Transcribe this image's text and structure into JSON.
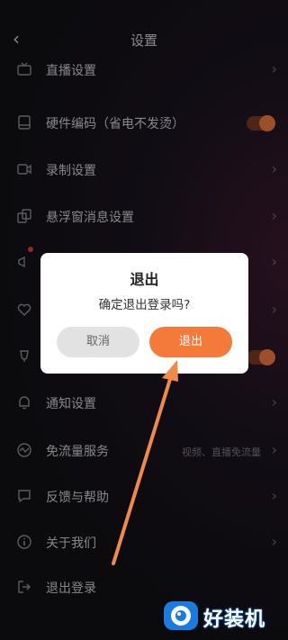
{
  "header": {
    "title": "设置",
    "back_icon": "chevron-left-icon"
  },
  "settings": {
    "items": [
      {
        "label": "直播设置",
        "icon": "tv-icon",
        "extra": "",
        "has_chevron": true
      },
      {
        "label": "硬件编码（省电不发烫）",
        "icon": "tablet-icon",
        "toggle": "on"
      },
      {
        "label": "录制设置",
        "icon": "video-camera-icon",
        "has_chevron": true
      },
      {
        "label": "悬浮窗消息设置",
        "icon": "floating-window-icon",
        "has_chevron": true
      },
      {
        "label": "",
        "icon": "megaphone-icon",
        "has_chevron": true
      },
      {
        "label": "",
        "icon": "heart-icon",
        "has_chevron": true
      },
      {
        "label": "",
        "icon": "trophy-icon",
        "toggle": "on"
      },
      {
        "label": "通知设置",
        "icon": "bell-icon",
        "has_chevron": true
      },
      {
        "label": "免流量服务",
        "icon": "wave-icon",
        "extra": "视频、直播免流量",
        "has_chevron": true
      },
      {
        "label": "反馈与帮助",
        "icon": "chat-icon",
        "has_chevron": true
      },
      {
        "label": "关于我们",
        "icon": "info-icon",
        "has_chevron": true
      },
      {
        "label": "退出登录",
        "icon": "logout-icon",
        "has_chevron": false
      }
    ]
  },
  "dialog": {
    "title": "退出",
    "message": "确定退出登录吗?",
    "cancel_label": "取消",
    "confirm_label": "退出"
  },
  "watermark": {
    "text": "好装机"
  },
  "colors": {
    "accent": "#f47a3a",
    "background": "#121116",
    "dialog": "#ffffff"
  }
}
